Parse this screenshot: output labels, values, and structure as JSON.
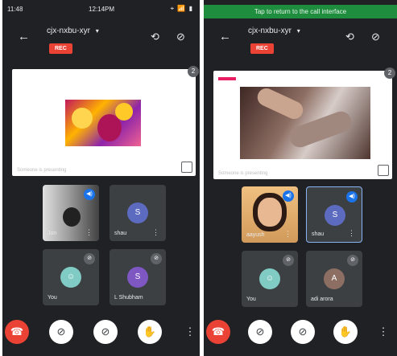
{
  "left": {
    "status": {
      "time_left": "11:48",
      "time_center": "12:14PM",
      "sys": "⌖ 📶 ▮"
    },
    "meeting": {
      "title": "cjx-nxbu-xyr",
      "rec": "REC"
    },
    "presentation": {
      "caption": "Someone is presenting",
      "badge": "2"
    },
    "tiles": [
      {
        "label": "Jon",
        "badge": "◀)",
        "video": true
      },
      {
        "label": "shau",
        "initial": "S",
        "avatar_color": "#5c6bc0",
        "badge": ""
      },
      {
        "label": "You",
        "initial": "☺",
        "avatar_color": "#80cbc4",
        "badge": "⊘"
      },
      {
        "label": "L Shubham",
        "initial": "S",
        "avatar_color": "#7e57c2",
        "badge": "⊘"
      }
    ]
  },
  "right": {
    "banner": "Tap to return to the call interface",
    "meeting": {
      "title": "cjx-nxbu-xyr",
      "rec": "REC"
    },
    "presentation": {
      "caption": "Someone is presenting",
      "badge": "2"
    },
    "tiles": [
      {
        "label": "aayush",
        "badge": "◀)",
        "video": true
      },
      {
        "label": "shau",
        "initial": "S",
        "avatar_color": "#5c6bc0",
        "badge": "◀)",
        "active": true
      },
      {
        "label": "You",
        "initial": "☺",
        "avatar_color": "#80cbc4",
        "badge": "⊘"
      },
      {
        "label": "adi arora",
        "initial": "A",
        "avatar_color": "#8d6e63",
        "badge": "⊘"
      }
    ]
  },
  "controls": {
    "end_call": "☎",
    "camera": "⊘",
    "mic": "⊘",
    "hand": "✋",
    "more": "⋮"
  },
  "icons": {
    "back": "←",
    "switch_camera": "⟲",
    "audio_off": "⊘",
    "chevron": "▾"
  }
}
